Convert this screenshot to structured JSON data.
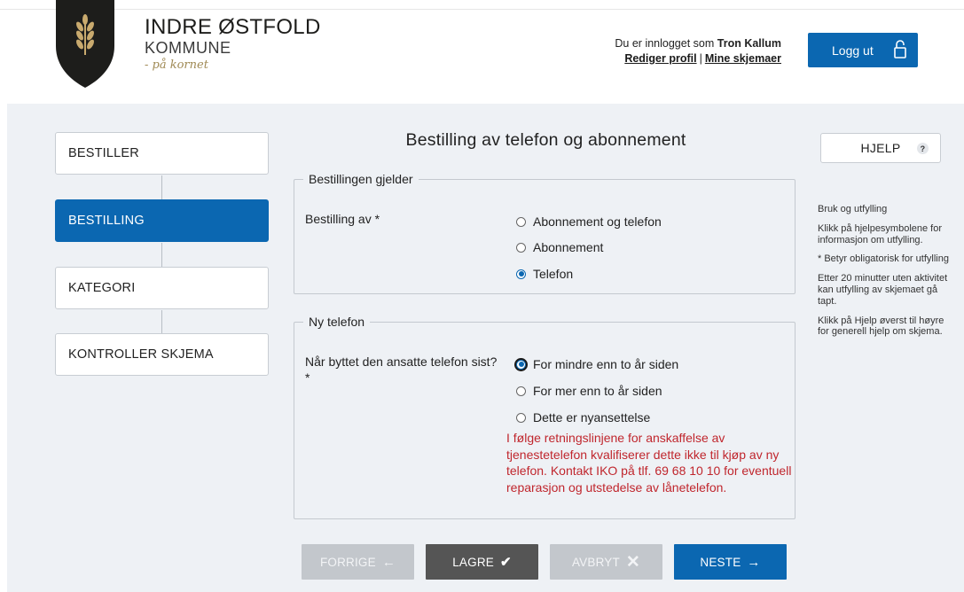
{
  "header": {
    "brand_name": "INDRE ØSTFOLD",
    "brand_sub": "KOMMUNE",
    "brand_tag": "- på kornet",
    "logged_in_prefix": "Du er innlogget som",
    "user_name": "Tron Kallum",
    "edit_profile": "Rediger profil",
    "separator": "|",
    "my_forms": "Mine skjemaer",
    "logout_label": "Logg ut"
  },
  "steps": [
    {
      "label": "BESTILLER",
      "active": false
    },
    {
      "label": "BESTILLING",
      "active": true
    },
    {
      "label": "KATEGORI",
      "active": false
    },
    {
      "label": "KONTROLLER SKJEMA",
      "active": false
    }
  ],
  "form": {
    "title": "Bestilling av telefon og abonnement",
    "section1": {
      "legend": "Bestillingen gjelder",
      "question": "Bestilling av *",
      "options": [
        "Abonnement og telefon",
        "Abonnement",
        "Telefon"
      ],
      "selected": "Telefon"
    },
    "section2": {
      "legend": "Ny telefon",
      "question": "Når byttet den ansatte telefon sist? *",
      "options": [
        "For mindre enn to år siden",
        "For mer enn to år siden",
        "Dette er nyansettelse"
      ],
      "selected": "For mindre enn to år siden",
      "warning": "I følge retningslinjene for anskaffelse av tjenestetelefon kvalifiserer dette ikke til kjøp av ny telefon. Kontakt IKO på tlf. 69 68 10 10 for eventuell reparasjon og utstedelse av lånetelefon."
    }
  },
  "buttons": {
    "prev": "FORRIGE",
    "save": "LAGRE",
    "cancel": "AVBRYT",
    "next": "NESTE"
  },
  "help": {
    "button_label": "HJELP",
    "button_icon": "?",
    "paragraphs": [
      "Bruk og utfylling",
      "Klikk på hjelpesymbolene for informasjon om utfylling.",
      "* Betyr obligatorisk for utfylling",
      "Etter 20 minutter uten aktivitet kan utfylling av skjemaet gå tapt.",
      "Klikk på Hjelp øverst til høyre for generell hjelp om skjema."
    ]
  },
  "colors": {
    "primary": "#0b67b1",
    "warning": "#c0262d",
    "background": "#eef1f5",
    "save_button": "#555555",
    "disabled_button": "#c3c7cc",
    "logo_gold": "#c9aa6e"
  }
}
